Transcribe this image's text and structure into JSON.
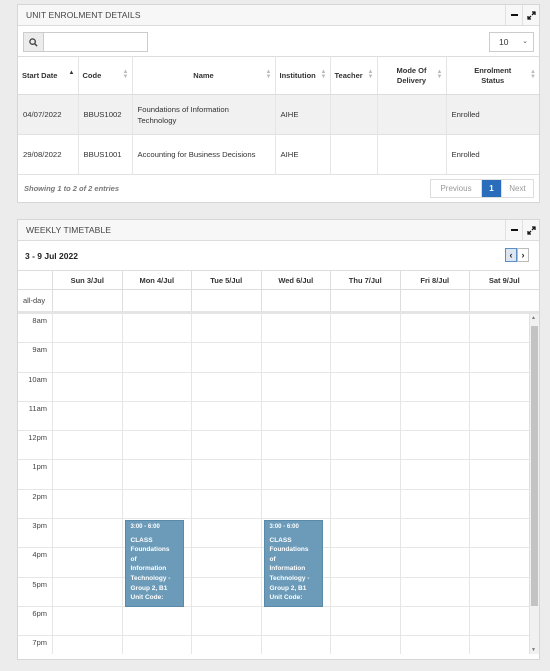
{
  "enrolment": {
    "title": "UNIT ENROLMENT DETAILS",
    "page_length": "10",
    "columns": [
      "Start Date",
      "Code",
      "Name",
      "Institution",
      "Teacher",
      "Mode Of Delivery",
      "Enrolment Status"
    ],
    "rows": [
      {
        "start": "04/07/2022",
        "code": "BBUS1002",
        "name": "Foundations of Information Technology",
        "institution": "AIHE",
        "teacher": "",
        "mode": "",
        "status": "Enrolled"
      },
      {
        "start": "29/08/2022",
        "code": "BBUS1001",
        "name": "Accounting for Business Decisions",
        "institution": "AIHE",
        "teacher": "",
        "mode": "",
        "status": "Enrolled"
      }
    ],
    "showing": "Showing 1 to 2 of 2 entries",
    "pager": {
      "prev": "Previous",
      "current": "1",
      "next": "Next"
    }
  },
  "timetable": {
    "title": "WEEKLY TIMETABLE",
    "range": "3 - 9 Jul 2022",
    "days": [
      "Sun 3/Jul",
      "Mon 4/Jul",
      "Tue 5/Jul",
      "Wed 6/Jul",
      "Thu 7/Jul",
      "Fri 8/Jul",
      "Sat 9/Jul"
    ],
    "allday_label": "all-day",
    "hours": [
      "8am",
      "9am",
      "10am",
      "11am",
      "12pm",
      "1pm",
      "2pm",
      "3pm",
      "4pm",
      "5pm",
      "6pm",
      "7pm"
    ],
    "events": [
      {
        "day": "Mon 4/Jul",
        "time": "3:00 - 6:00",
        "title": "CLASS\nFoundations\nof\nInformation\nTechnology -\nGroup 2, B1\nUnit Code:"
      },
      {
        "day": "Wed 6/Jul",
        "time": "3:00 - 6:00",
        "title": "CLASS\nFoundations\nof\nInformation\nTechnology -\nGroup 2, B1\nUnit Code:"
      }
    ]
  },
  "colors": {
    "accent": "#2a6ebb",
    "event": "#6b9bb9"
  },
  "icons": [
    "search-icon",
    "minimize-icon",
    "expand-icon",
    "chevron-down-icon",
    "chevron-left-icon",
    "chevron-right-icon",
    "sort-icon"
  ]
}
